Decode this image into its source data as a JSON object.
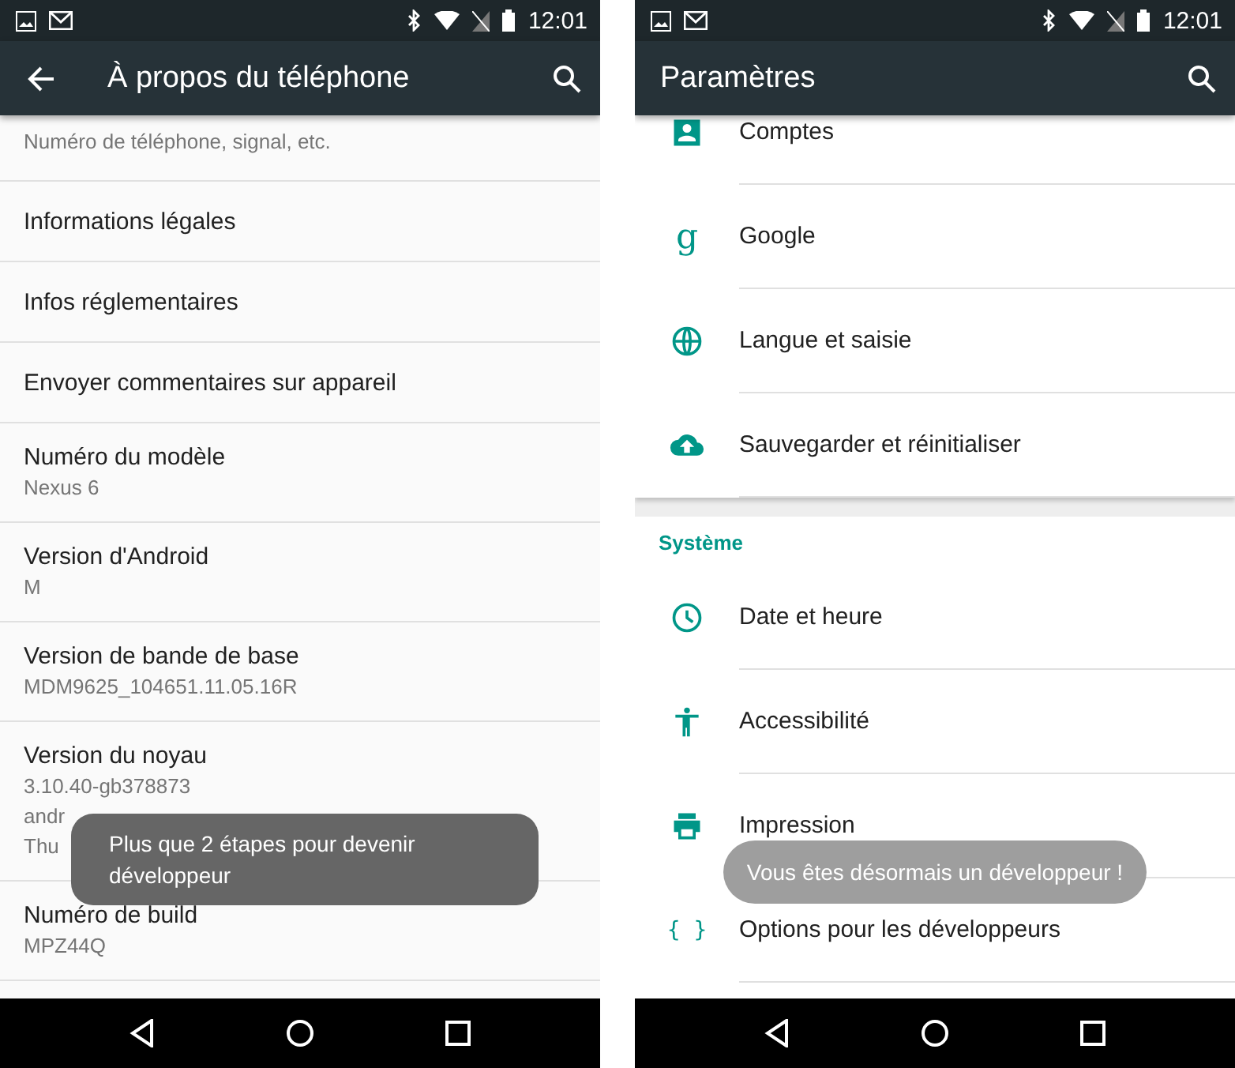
{
  "screens": [
    {
      "kind": "about",
      "status_time": "12:01",
      "title": "À propos du téléphone",
      "back": true,
      "rows": [
        {
          "summary": [
            "Numéro de téléphone, signal, etc."
          ]
        },
        {
          "title": "Informations légales"
        },
        {
          "title": "Infos réglementaires"
        },
        {
          "title": "Envoyer commentaires sur appareil"
        },
        {
          "title": "Numéro du modèle",
          "summary": [
            "Nexus 6"
          ]
        },
        {
          "title": "Version d'Android",
          "summary": [
            "M"
          ]
        },
        {
          "title": "Version de bande de base",
          "summary": [
            "MDM9625_104651.11.05.16R"
          ]
        },
        {
          "title": "Version du noyau",
          "summary": [
            "3.10.40-gb378873",
            "andr",
            "Thu"
          ]
        },
        {
          "title": "Numéro de build",
          "summary": [
            "MPZ44Q"
          ]
        }
      ],
      "toast": {
        "text": "Plus que 2 étapes pour devenir développeur"
      }
    },
    {
      "kind": "settings",
      "status_time": "12:01",
      "title": "Paramètres",
      "back": false,
      "sections": [
        {
          "rows": [
            {
              "title": "Comptes"
            },
            {
              "title": "Google",
              "icon_text": "g"
            },
            {
              "title": "Langue et saisie"
            },
            {
              "title": "Sauvegarder et réinitialiser"
            }
          ]
        },
        {
          "header": "Système",
          "rows": [
            {
              "title": "Date et heure"
            },
            {
              "title": "Accessibilité"
            },
            {
              "title": "Impression"
            },
            {
              "title": "Options pour les développeurs",
              "icon_text": "{ }"
            }
          ]
        }
      ],
      "toast": {
        "text": "Vous êtes désormais un développeur !"
      }
    }
  ]
}
